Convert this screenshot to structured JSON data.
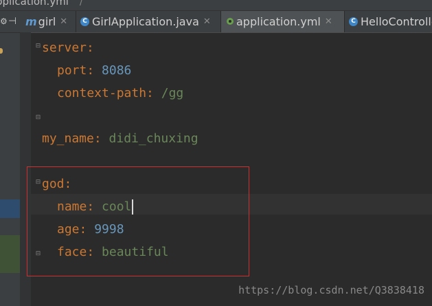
{
  "breadcrumb": {
    "text": "pplication.yml",
    "separator": "/"
  },
  "tabs": [
    {
      "label": "girl",
      "icon": "module-icon",
      "active": false
    },
    {
      "label": "GirlApplication.java",
      "icon": "class-icon",
      "active": false
    },
    {
      "label": "application.yml",
      "icon": "yaml-file-icon",
      "active": true
    },
    {
      "label": "HelloControlle",
      "icon": "class-icon",
      "active": false
    }
  ],
  "editor": {
    "lines": [
      {
        "key": "server",
        "value": ""
      },
      {
        "key": "port",
        "value": "8086"
      },
      {
        "key": "context-path",
        "value": "/gg"
      },
      {
        "key": "my_name",
        "value": "didi_chuxing"
      },
      {
        "key": "god",
        "value": ""
      },
      {
        "key": "name",
        "value": "cool"
      },
      {
        "key": "age",
        "value": "9998"
      },
      {
        "key": "face",
        "value": "beautiful"
      }
    ]
  },
  "watermark": "https://blog.csdn.net/Q3838418",
  "colors": {
    "key": "#cc7832",
    "string": "#6a8759",
    "number": "#6897bb",
    "highlight_box": "#d0302d"
  }
}
